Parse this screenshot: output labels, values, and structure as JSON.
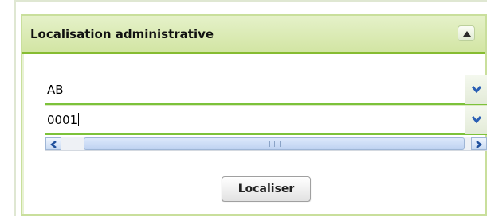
{
  "panel": {
    "title": "Localisation administrative",
    "collapse_icon": "collapse-up-icon"
  },
  "form": {
    "field1": {
      "value": "AB",
      "dropdown_icon": "chevron-down-icon"
    },
    "field2": {
      "value": "0001",
      "dropdown_icon": "chevron-down-icon"
    },
    "scrollbar": {
      "left_icon": "arrow-left-icon",
      "right_icon": "arrow-right-icon",
      "grip_icon": "grip-icon"
    }
  },
  "actions": {
    "localiser_label": "Localiser"
  },
  "colors": {
    "header_accent": "#86bc31",
    "field_accent": "#7cc23a",
    "icon_blue": "#2a5fb4"
  }
}
